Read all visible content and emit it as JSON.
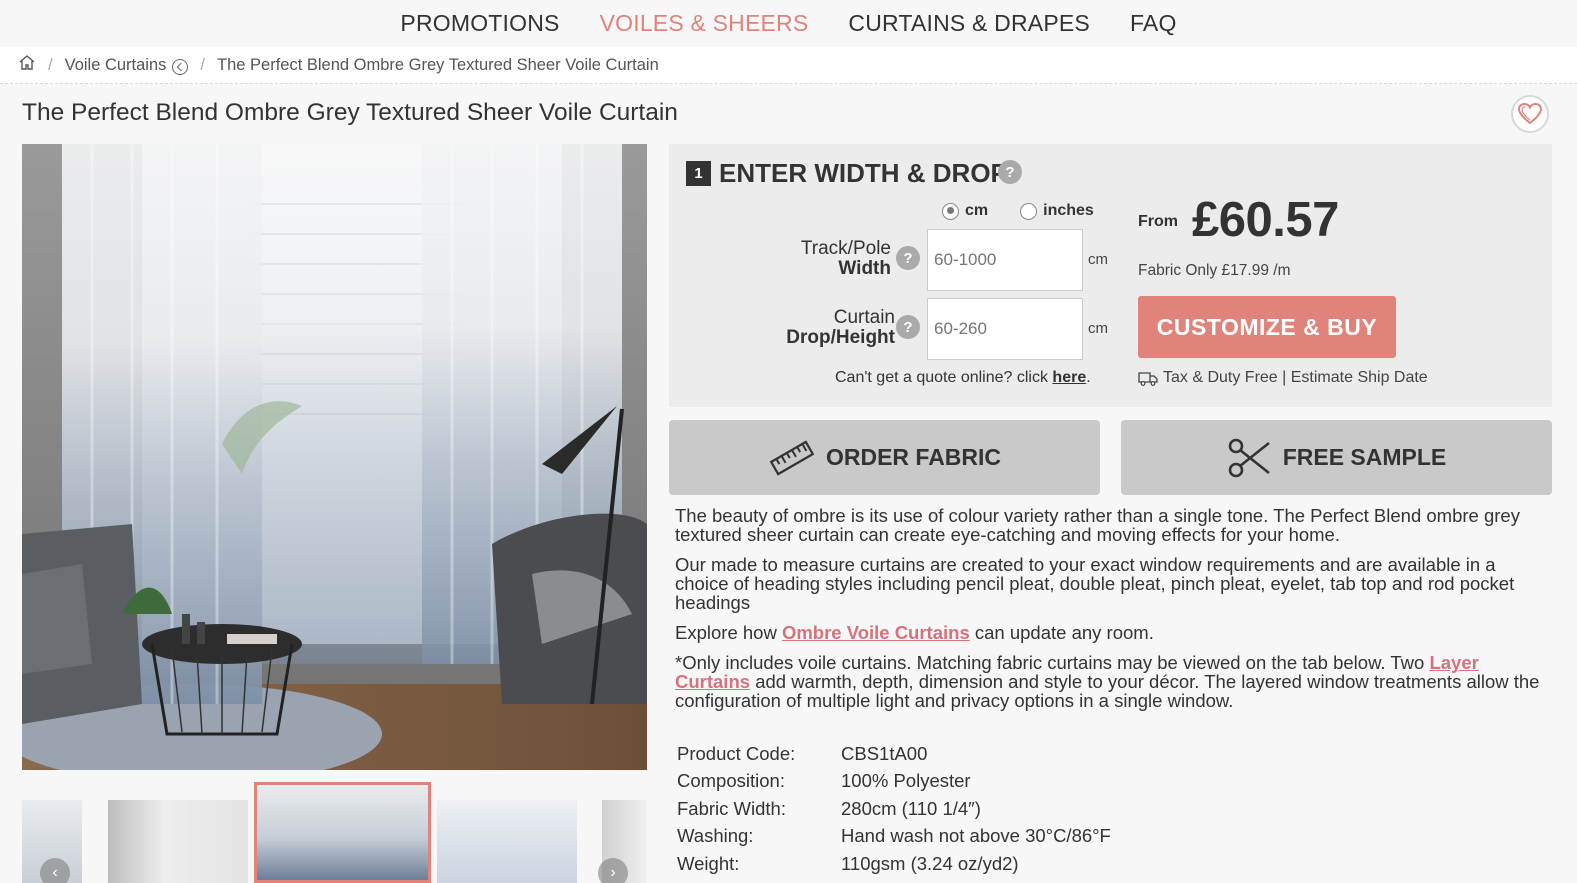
{
  "nav": {
    "items": [
      {
        "label": "PROMOTIONS"
      },
      {
        "label": "VOILES & SHEERS"
      },
      {
        "label": "CURTAINS & DRAPES"
      },
      {
        "label": "FAQ"
      }
    ]
  },
  "breadcrumb": {
    "category": "Voile Curtains",
    "current": "The Perfect Blend Ombre Grey Textured Sheer Voile Curtain"
  },
  "product": {
    "title": "The Perfect Blend Ombre Grey Textured Sheer Voile Curtain"
  },
  "configurator": {
    "step_number": "1",
    "heading": "ENTER WIDTH & DROP",
    "unit_cm": "cm",
    "unit_inches": "inches",
    "width_label_1": "Track/Pole",
    "width_label_2": "Width",
    "width_placeholder": "60-1000",
    "width_unit": "cm",
    "drop_label_1": "Curtain",
    "drop_label_2": "Drop/Height",
    "drop_placeholder": "60-260",
    "drop_unit": "cm",
    "quote_text": "Can't get a quote online? click",
    "quote_link": "here"
  },
  "pricing": {
    "from_label": "From",
    "price": "£60.57",
    "fabric_only": "Fabric Only £17.99 /m",
    "buy_label": "CUSTOMIZE  &  BUY",
    "shipping": "Tax & Duty Free | Estimate Ship Date"
  },
  "actions": {
    "order_fabric": "ORDER FABRIC",
    "free_sample": "FREE SAMPLE"
  },
  "description": {
    "p1": "The beauty of ombre is its use of colour variety rather than a single tone. The Perfect Blend ombre grey textured sheer curtain can create eye-catching and moving effects for your home.",
    "p2": "Our made to measure curtains are created to your exact window requirements and are available in a choice of heading styles including pencil pleat, double pleat, pinch pleat, eyelet, tab top and rod pocket headings",
    "p3_pre": "Explore how",
    "p3_link": "Ombre Voile Curtains",
    "p3_post": "can update any room.",
    "p4_pre": "*Only includes voile curtains. Matching fabric curtains may be viewed on the tab below. Two",
    "p4_link": "Layer Curtains",
    "p4_post": "add warmth, depth, dimension and style to your décor. The layered window treatments allow the configuration of multiple light and privacy options in a single window."
  },
  "specs": [
    {
      "key": "Product Code:",
      "value": "CBS1tA00"
    },
    {
      "key": "Composition:",
      "value": "100% Polyester"
    },
    {
      "key": "Fabric Width:",
      "value": "280cm (110 1/4″)"
    },
    {
      "key": "Washing:",
      "value": "Hand wash not above 30°C/86°F"
    },
    {
      "key": "Weight:",
      "value": "110gsm (3.24 oz/yd2)"
    }
  ],
  "colors": {
    "accent": "#e0837a",
    "link": "#d4737c",
    "panel": "#ececec",
    "button_grey": "#c9c9c9"
  },
  "icons": [
    "home-icon",
    "back-circle-icon",
    "heart-icon",
    "question-icon",
    "ruler-icon",
    "scissors-icon",
    "truck-icon",
    "chevron-left-icon",
    "chevron-right-icon"
  ]
}
